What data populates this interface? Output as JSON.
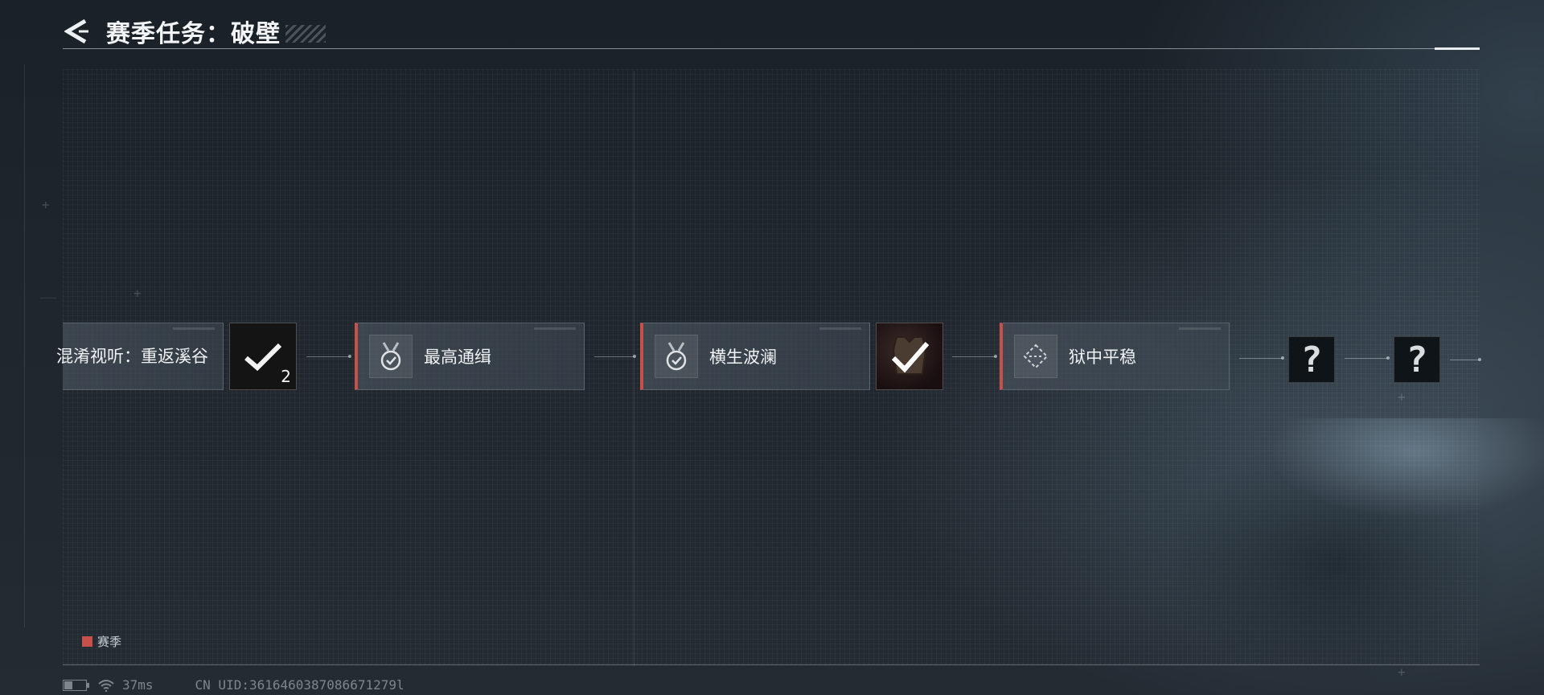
{
  "header": {
    "title": "赛季任务：破壁"
  },
  "tasks": [
    {
      "label": "混淆视听：重返溪谷",
      "icon": "task-partial"
    },
    {
      "label": "最高通缉",
      "icon": "medal-check-icon"
    },
    {
      "label": "横生波澜",
      "icon": "medal-check-icon"
    },
    {
      "label": "狱中平稳",
      "icon": "route-diamond-icon"
    }
  ],
  "rewards": [
    {
      "count": "2",
      "icon": "check-icon",
      "state": "claimed"
    },
    {
      "count": "",
      "icon": "vest-check-icon",
      "state": "claimed"
    }
  ],
  "locked": [
    {
      "glyph": "?"
    },
    {
      "glyph": "?"
    }
  ],
  "legend": {
    "label": "赛季",
    "color": "#c8504a"
  },
  "status": {
    "ping": "37ms",
    "uid": "CN UID:3616460387086671279l"
  },
  "colors": {
    "accent": "#c8504a",
    "background": "#1f262d"
  }
}
